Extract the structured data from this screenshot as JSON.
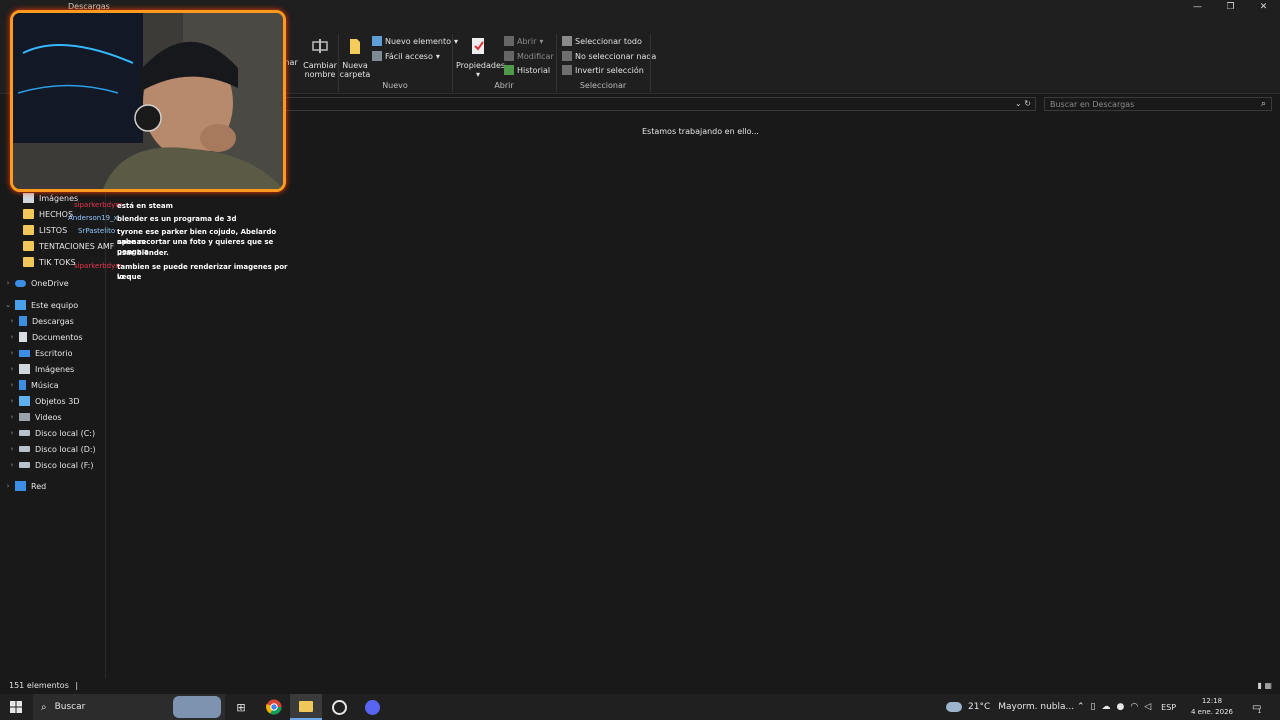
{
  "window": {
    "title": "Descargas",
    "controls": [
      "—",
      "❐",
      "✕"
    ],
    "help": "?"
  },
  "ribbon": {
    "organize": {
      "partial": "inar",
      "rename": [
        "Cambiar",
        "nombre"
      ]
    },
    "new": {
      "caption": "Nuevo",
      "new_folder": [
        "Nueva",
        "carpeta"
      ],
      "new_item": "Nuevo elemento",
      "easy_access": "Fácil acceso"
    },
    "open": {
      "caption": "Abrir",
      "properties": "Propiedades",
      "open": "Abrir",
      "modify": "Modificar",
      "history": "Historial"
    },
    "select": {
      "caption": "Seleccionar",
      "select_all": "Seleccionar todo",
      "select_none": "No seleccionar nada",
      "invert": "Invertir selección"
    }
  },
  "search": {
    "placeholder": "Buscar en Descargas"
  },
  "main": {
    "message": "Estamos trabajando en ello..."
  },
  "nav": {
    "quick": [
      {
        "label": "Imágenes"
      },
      {
        "label": "HECHOS"
      },
      {
        "label": "LISTOS"
      },
      {
        "label": "TENTACIONES AMF"
      },
      {
        "label": "TIK TOKS"
      }
    ],
    "onedrive": "OneDrive",
    "this_pc": "Este equipo",
    "pc_items": [
      {
        "label": "Descargas",
        "icon": "download-icon"
      },
      {
        "label": "Documentos",
        "icon": "document-icon"
      },
      {
        "label": "Escritorio",
        "icon": "desktop-icon"
      },
      {
        "label": "Imágenes",
        "icon": "pictures-icon"
      },
      {
        "label": "Música",
        "icon": "music-icon"
      },
      {
        "label": "Objetos 3D",
        "icon": "cube-icon"
      },
      {
        "label": "Videos",
        "icon": "video-icon"
      },
      {
        "label": "Disco local (C:)",
        "icon": "drive-icon"
      },
      {
        "label": "Disco local (D:)",
        "icon": "drive-icon"
      },
      {
        "label": "Disco local (F:)",
        "icon": "drive-icon"
      }
    ],
    "network": "Red"
  },
  "chat": {
    "users": [
      "siparkerbdyro",
      "Anderson19_x",
      "SrPastelito",
      "siparkerbdyro"
    ],
    "messages": [
      "está en steam",
      "blender es un programa de 3d",
      "tyrone ese parker bien cojudo, Abelardo apenas",
      "sabe recortar una foto y quieres que se ponga a",
      "usar blender.",
      "tambien se puede renderizar imagenes por lo que",
      "veo"
    ]
  },
  "status": {
    "count": "151 elementos",
    "sep": "|"
  },
  "taskbar": {
    "search": "Buscar",
    "weather_temp": "21°C",
    "weather_text": "Mayorm. nubla...",
    "lang": "ESP",
    "time": "12:18",
    "date": "4 ene. 2026",
    "notif": "1"
  },
  "colors": {
    "accent": "#2b79d0",
    "overlay_border": "#ff9a1f",
    "chat_user": "#e8354c"
  }
}
